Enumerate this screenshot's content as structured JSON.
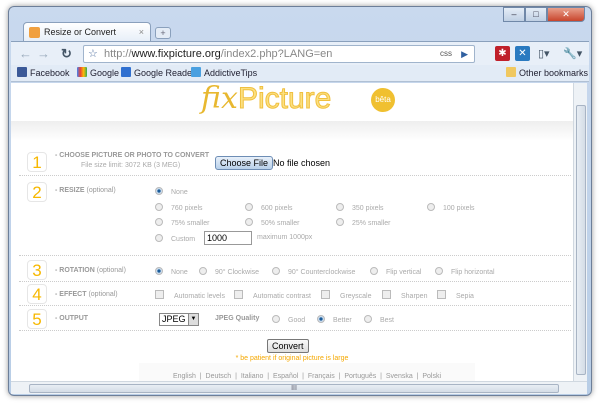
{
  "browser": {
    "tab_title": "Resize or Convert Images...",
    "url_prefix": "http://",
    "url_domain": "www.fixpicture.org",
    "url_path": "/index2.php?LANG=en",
    "css_badge": "css",
    "bookmarks": [
      "Facebook",
      "Google",
      "Google Reader",
      "AddictiveTips"
    ],
    "other_bookmarks": "Other bookmarks"
  },
  "logo": {
    "text_fix": "fix",
    "text_picture": "Picture",
    "badge": "bêta"
  },
  "steps": [
    {
      "num": "1",
      "label": "- CHOOSE PICTURE OR PHOTO TO CONVERT",
      "sub": "File size limit: 3072 KB (3 MEG)",
      "button": "Choose File",
      "status": "No file chosen"
    },
    {
      "num": "2",
      "label": "- RESIZE",
      "opt": "(optional)",
      "options": [
        "None",
        "760 pixels",
        "600 pixels",
        "350 pixels",
        "100 pixels",
        "75% smaller",
        "50% smaller",
        "25% smaller",
        "Custom"
      ],
      "selected": "None",
      "custom_value": "1000",
      "custom_hint": "maximum 1000px"
    },
    {
      "num": "3",
      "label": "- ROTATION",
      "opt": "(optional)",
      "options": [
        "None",
        "90° Clockwise",
        "90° Counterclockwise",
        "Flip vertical",
        "Flip horizontal"
      ],
      "selected": "None"
    },
    {
      "num": "4",
      "label": "- EFFECT",
      "opt": "(optional)",
      "options": [
        "Automatic levels",
        "Automatic contrast",
        "Greyscale",
        "Sharpen",
        "Sepia"
      ]
    },
    {
      "num": "5",
      "label": "- OUTPUT",
      "format": "JPEG",
      "quality_label": "JPEG Quality",
      "options": [
        "Good",
        "Better",
        "Best"
      ],
      "selected": "Better"
    }
  ],
  "convert": "Convert",
  "note": "* be patient if original picture is large",
  "languages": [
    "English",
    "Deutsch",
    "Italiano",
    "Español",
    "Français",
    "Português",
    "Svenska",
    "Polski"
  ],
  "scroll_grip": "III"
}
